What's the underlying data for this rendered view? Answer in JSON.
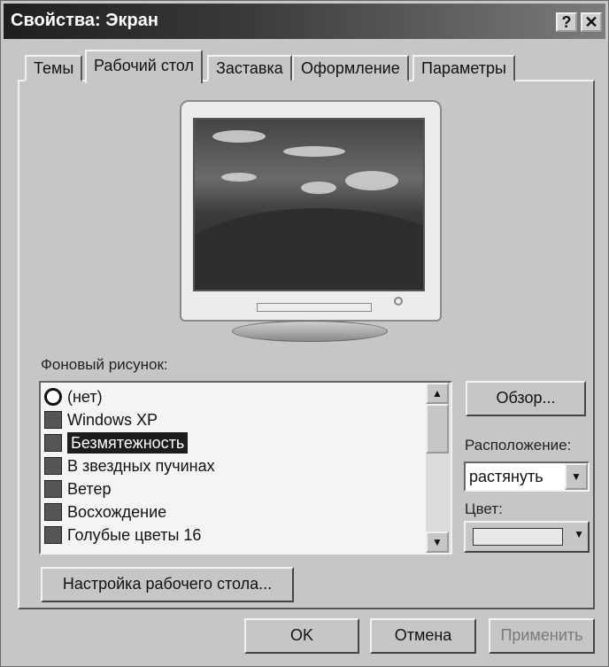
{
  "window": {
    "title": "Свойства: Экран"
  },
  "titlebar_buttons": {
    "help": "?",
    "close": "✕"
  },
  "tabs": [
    {
      "label": "Темы"
    },
    {
      "label": "Рабочий стол"
    },
    {
      "label": "Заставка"
    },
    {
      "label": "Оформление"
    },
    {
      "label": "Параметры"
    }
  ],
  "background": {
    "label": "Фоновый рисунок:",
    "items": [
      {
        "label": "(нет)",
        "icon": "none-icon"
      },
      {
        "label": "Windows XP",
        "icon": "image-file-icon"
      },
      {
        "label": "Безмятежность",
        "icon": "image-file-icon",
        "selected": true
      },
      {
        "label": "В звездных пучинах",
        "icon": "image-file-icon"
      },
      {
        "label": "Ветер",
        "icon": "image-file-icon"
      },
      {
        "label": "Восхождение",
        "icon": "image-file-icon"
      },
      {
        "label": "Голубые цветы 16",
        "icon": "image-file-icon"
      }
    ]
  },
  "browse_label": "Обзор...",
  "position": {
    "label": "Расположение:",
    "value": "растянуть"
  },
  "color": {
    "label": "Цвет:"
  },
  "customize_label": "Настройка рабочего стола...",
  "footer": {
    "ok": "OK",
    "cancel": "Отмена",
    "apply": "Применить"
  }
}
